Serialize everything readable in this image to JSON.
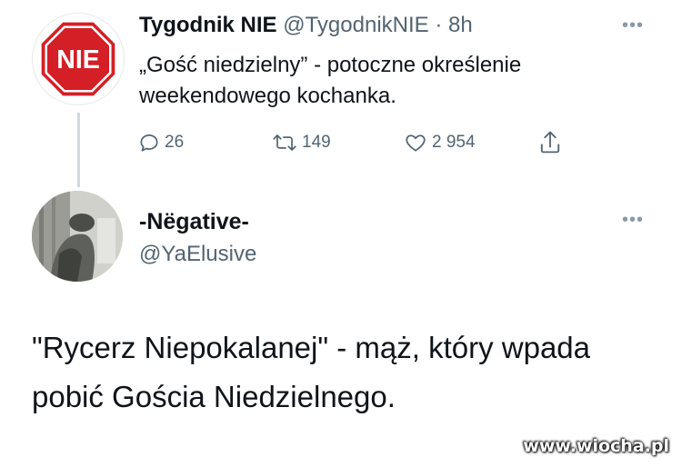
{
  "tweet1": {
    "display_name": "Tygodnik NIE",
    "handle": "@TygodnikNIE",
    "separator": "·",
    "time": "8h",
    "avatar_text": "NIE",
    "text": "„Gość niedzielny” - potoczne określenie weekendowego kochanka.",
    "actions": {
      "reply_count": "26",
      "retweet_count": "149",
      "like_count": "2 954"
    }
  },
  "tweet2": {
    "display_name": "-Nëgative-",
    "handle": "@YaElusive",
    "text": "\"Rycerz Niepokalanej\" - mąż, który wpada pobić Gościa Niedzielnego."
  },
  "watermark": "www.wiocha.pl",
  "colors": {
    "text_primary": "#0f1419",
    "text_secondary": "#536471",
    "thread_line": "#cfd9de",
    "nie_red": "#d41f26"
  },
  "icons": {
    "more": "more-horizontal-icon",
    "reply": "reply-bubble-icon",
    "retweet": "retweet-icon",
    "like": "heart-outline-icon",
    "share": "share-upload-icon"
  }
}
